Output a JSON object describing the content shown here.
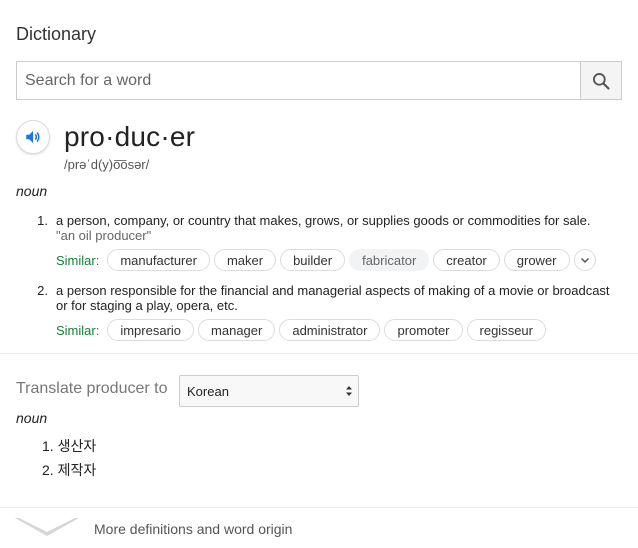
{
  "app": {
    "title": "Dictionary"
  },
  "search": {
    "placeholder": "Search for a word",
    "value": ""
  },
  "entry": {
    "word": "pro·duc·er",
    "phonetic": "/prəˈd(y)o͞osər/",
    "part_of_speech": "noun",
    "definitions": [
      {
        "number": "1.",
        "text": "a person, company, or country that makes, grows, or supplies goods or commodities for sale.",
        "example": "\"an oil producer\"",
        "similar_label": "Similar:",
        "similar": [
          "manufacturer",
          "maker",
          "builder",
          "fabricator",
          "creator",
          "grower"
        ],
        "highlighted": "fabricator"
      },
      {
        "number": "2.",
        "text": "a person responsible for the financial and managerial aspects of making of a movie or broadcast or for staging a play, opera, etc.",
        "similar_label": "Similar:",
        "similar": [
          "impresario",
          "manager",
          "administrator",
          "promoter",
          "regisseur"
        ]
      }
    ]
  },
  "translate": {
    "label": "Translate producer to",
    "selected_language": "Korean",
    "part_of_speech": "noun",
    "items": [
      {
        "number": "1.",
        "text": "생산자"
      },
      {
        "number": "2.",
        "text": "제작자"
      }
    ]
  },
  "footer": {
    "more_label": "More definitions and word origin"
  },
  "colors": {
    "similar_label": "#188038",
    "chip_border": "#dadce0",
    "audio_icon": "#1a73e8"
  }
}
